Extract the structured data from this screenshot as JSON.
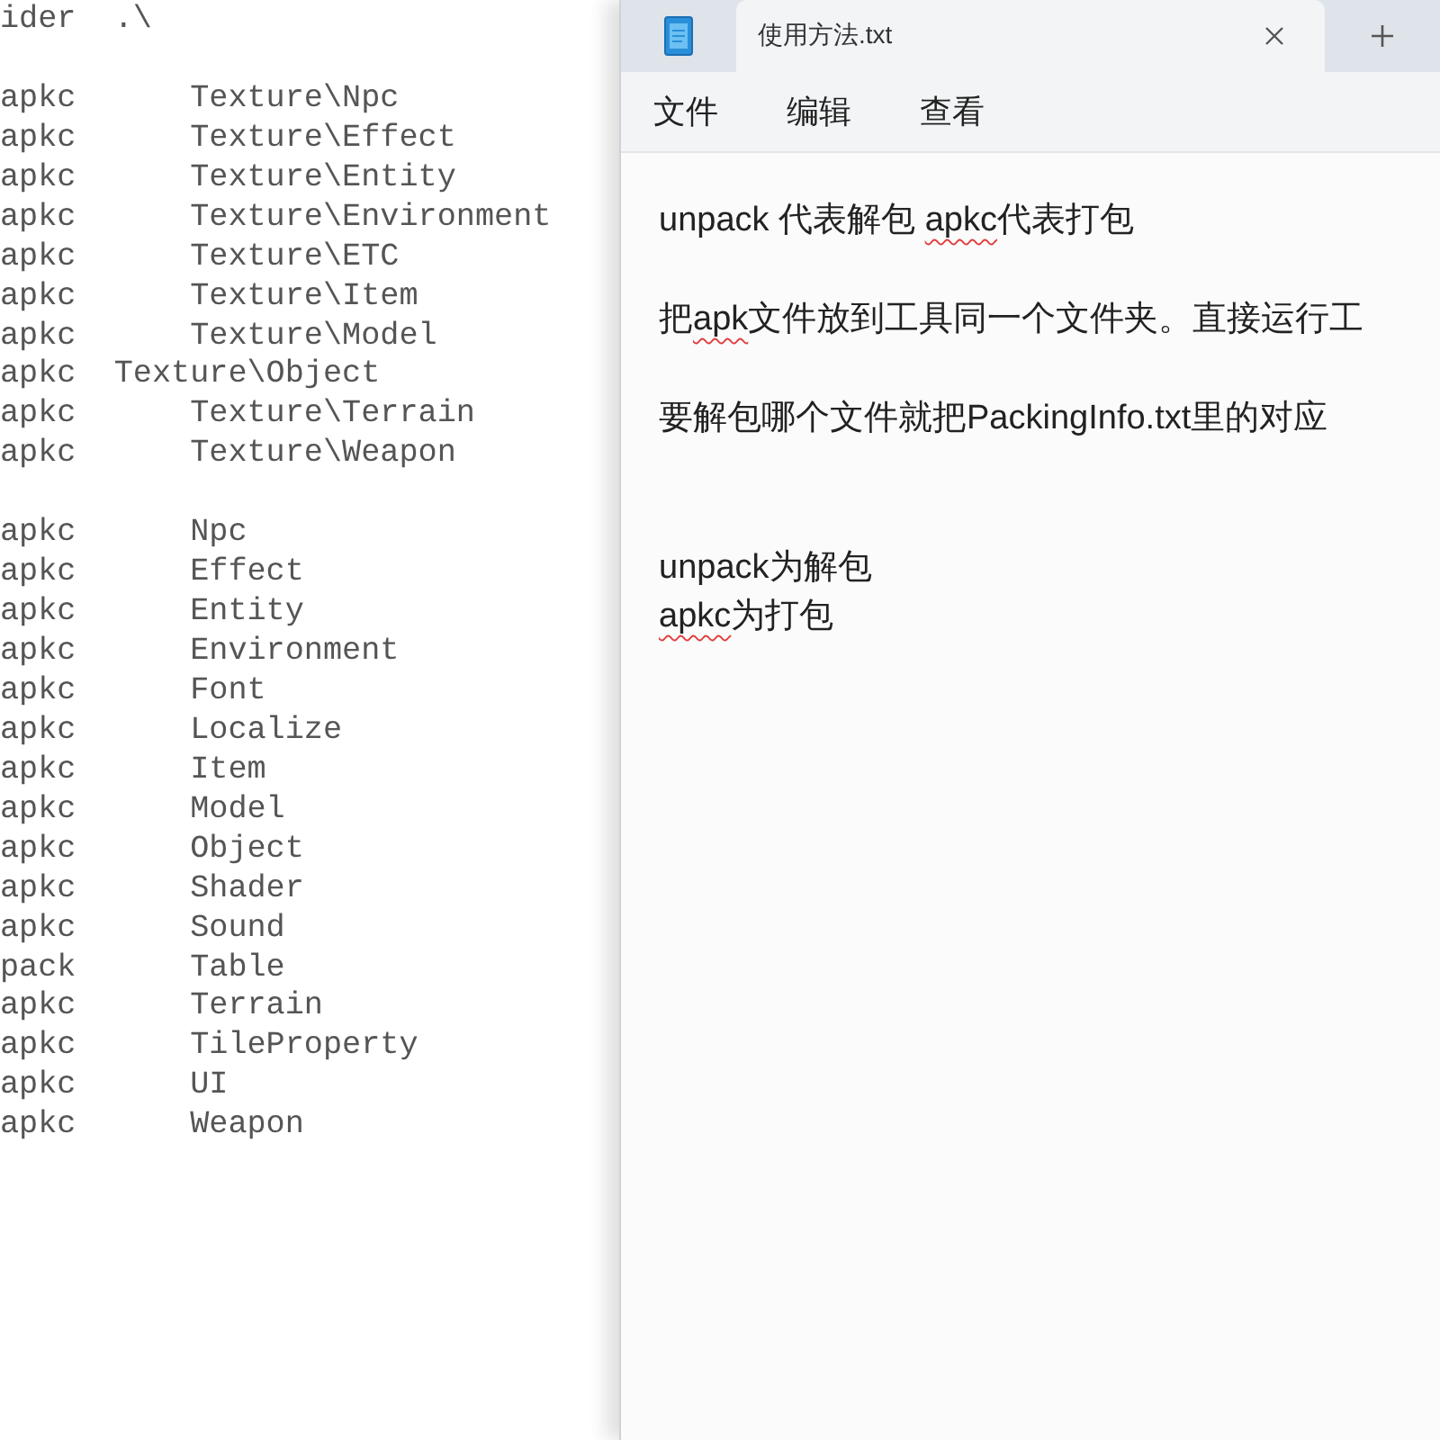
{
  "left_pane": {
    "lines": [
      {
        "kind": "text",
        "text": "ider  .\\"
      },
      {
        "kind": "blank"
      },
      {
        "kind": "text",
        "text": "apkc      Texture\\Npc"
      },
      {
        "kind": "text",
        "text": "apkc      Texture\\Effect"
      },
      {
        "kind": "text",
        "text": "apkc      Texture\\Entity"
      },
      {
        "kind": "text",
        "text": "apkc      Texture\\Environment"
      },
      {
        "kind": "text",
        "text": "apkc      Texture\\ETC"
      },
      {
        "kind": "text",
        "text": "apkc      Texture\\Item"
      },
      {
        "kind": "text",
        "text": "apkc      Texture\\Model"
      },
      {
        "kind": "text",
        "text": "apkc  Texture\\Object"
      },
      {
        "kind": "text",
        "text": "apkc      Texture\\Terrain"
      },
      {
        "kind": "text",
        "text": "apkc      Texture\\Weapon"
      },
      {
        "kind": "blank"
      },
      {
        "kind": "text",
        "text": "apkc      Npc"
      },
      {
        "kind": "text",
        "text": "apkc      Effect"
      },
      {
        "kind": "text",
        "text": "apkc      Entity"
      },
      {
        "kind": "text",
        "text": "apkc      Environment"
      },
      {
        "kind": "text",
        "text": "apkc      Font"
      },
      {
        "kind": "text",
        "text": "apkc      Localize"
      },
      {
        "kind": "text",
        "text": "apkc      Item"
      },
      {
        "kind": "text",
        "text": "apkc      Model"
      },
      {
        "kind": "text",
        "text": "apkc      Object"
      },
      {
        "kind": "text",
        "text": "apkc      Shader"
      },
      {
        "kind": "text",
        "text": "apkc      Sound"
      },
      {
        "kind": "text",
        "text": "pack      Table"
      },
      {
        "kind": "text",
        "text": "apkc      Terrain"
      },
      {
        "kind": "text",
        "text": "apkc      TileProperty"
      },
      {
        "kind": "text",
        "text": "apkc      UI"
      },
      {
        "kind": "text",
        "text": "apkc      Weapon"
      }
    ]
  },
  "notepad": {
    "tabs": [
      {
        "label": "使用方法.txt",
        "selected": true
      }
    ],
    "menu": [
      "文件",
      "编辑",
      "查看"
    ],
    "document": {
      "lines": [
        {
          "kind": "text",
          "runs": [
            {
              "text": "unpack 代表解包 ",
              "misspelled": false
            },
            {
              "text": "apkc",
              "misspelled": true
            },
            {
              "text": "代表打包",
              "misspelled": false
            }
          ]
        },
        {
          "kind": "blank"
        },
        {
          "kind": "text",
          "runs": [
            {
              "text": "把",
              "misspelled": false
            },
            {
              "text": "apk",
              "misspelled": true
            },
            {
              "text": "文件放到工具同一个文件夹。直接运行工",
              "misspelled": false
            }
          ]
        },
        {
          "kind": "blank"
        },
        {
          "kind": "text",
          "runs": [
            {
              "text": "要解包哪个文件就把PackingInfo.txt里的对应",
              "misspelled": false
            }
          ]
        },
        {
          "kind": "blank"
        },
        {
          "kind": "blank"
        },
        {
          "kind": "text",
          "runs": [
            {
              "text": "unpack为解包",
              "misspelled": false
            }
          ]
        },
        {
          "kind": "text",
          "runs": [
            {
              "text": "apkc",
              "misspelled": true
            },
            {
              "text": "为打包",
              "misspelled": false
            }
          ]
        }
      ]
    }
  }
}
